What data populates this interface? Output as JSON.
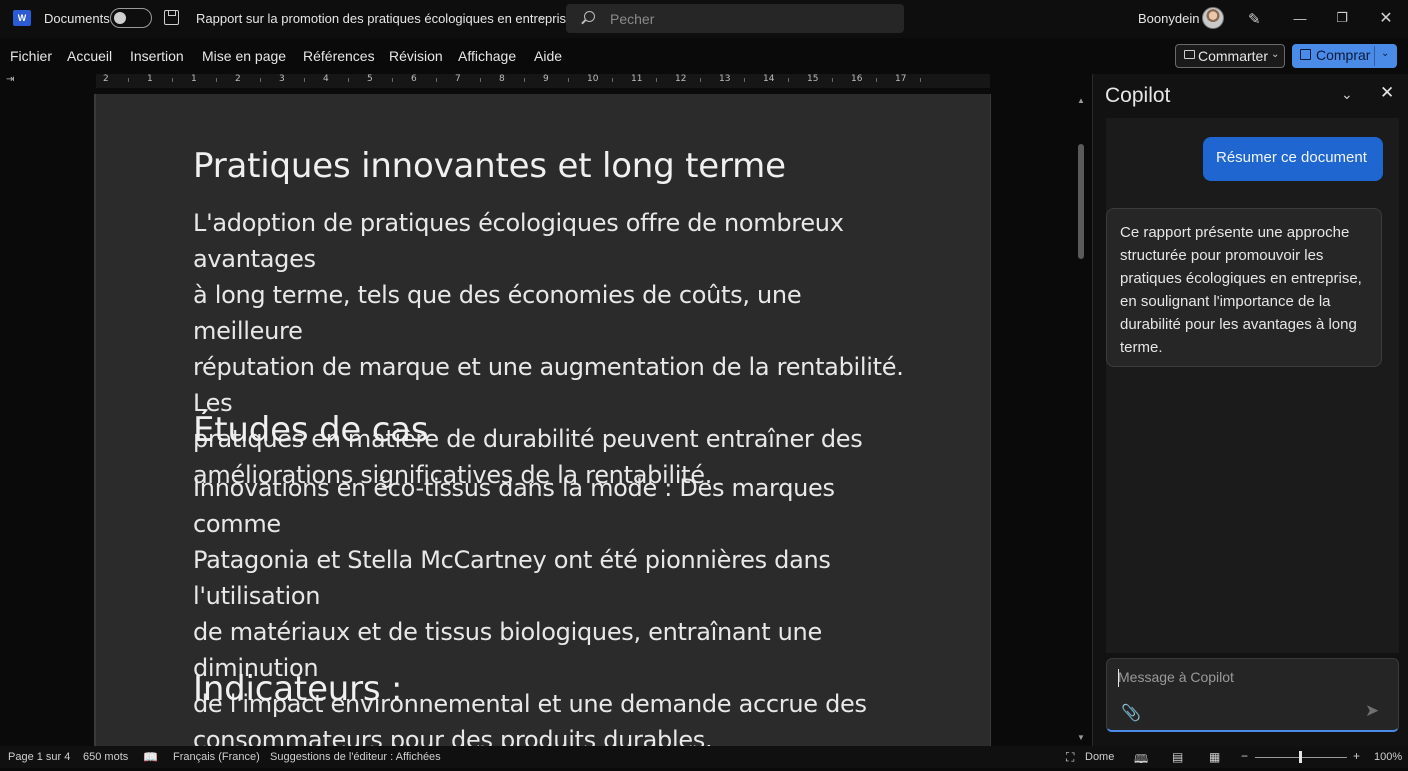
{
  "titlebar": {
    "app_icon": "word-icon",
    "autosave_label": "Documents",
    "autosave_on": false,
    "doc_title": "Rapport sur la promotion des pratiques écologiques en entreprise",
    "search_placeholder": "Pecher",
    "user_name": "Boonydein",
    "window_controls": [
      "minimize",
      "restore",
      "close"
    ]
  },
  "menu": {
    "items": [
      "Fichier",
      "Accueil",
      "Insertion",
      "Mise en page",
      "Références",
      "Révision",
      "Affichage",
      "Aide"
    ],
    "comment_label": "Commarter",
    "share_label": "Comprar"
  },
  "ruler": {
    "numbers": [
      "2",
      "1",
      "1",
      "2",
      "3",
      "4",
      "5",
      "6",
      "7",
      "8",
      "9",
      "10",
      "11",
      "12",
      "13",
      "14",
      "15",
      "16",
      "17"
    ]
  },
  "document": {
    "heading1": "Pratiques innovantes et long terme",
    "para1_lines": [
      "L'adoption de pratiques écologiques offre de nombreux avantages",
      "à long terme, tels que des économies de coûts, une meilleure",
      "réputation de marque et une augmentation de la rentabilité. Les",
      "pratiques en matière de durabilité peuvent entraîner des",
      "améliorations significatives de la rentabilité."
    ],
    "heading2": "Études de cas",
    "para2_lines": [
      "Innovations en éco-tissus dans la mode : Des marques comme",
      "Patagonia et Stella McCartney ont été pionnières dans l'utilisation",
      "de matériaux et de tissus biologiques, entraînant une diminution",
      "de l'impact environnemental et une demande accrue des",
      "consommateurs pour des produits durables."
    ],
    "heading3": "Indicateurs :"
  },
  "copilot": {
    "title": "Copilot",
    "user_message": "Résumer ce document",
    "ai_message": "Ce rapport présente une approche structurée pour promouvoir les pratiques écologiques en entreprise, en soulignant l'importance de la durabilité pour les avantages à long terme.",
    "input_placeholder": "Message à Copilot"
  },
  "statusbar": {
    "page": "Page 1 sur 4",
    "words": "650 mots",
    "language": "Français (France)",
    "suggestions": "Suggestions de l'éditeur : Affichées",
    "focus": "Dome",
    "zoom": "100%",
    "zoom_level": 1.0
  },
  "colors": {
    "accent": "#4a8be8",
    "user_bubble": "#1f66d1",
    "page_bg": "#2b2b2b"
  }
}
